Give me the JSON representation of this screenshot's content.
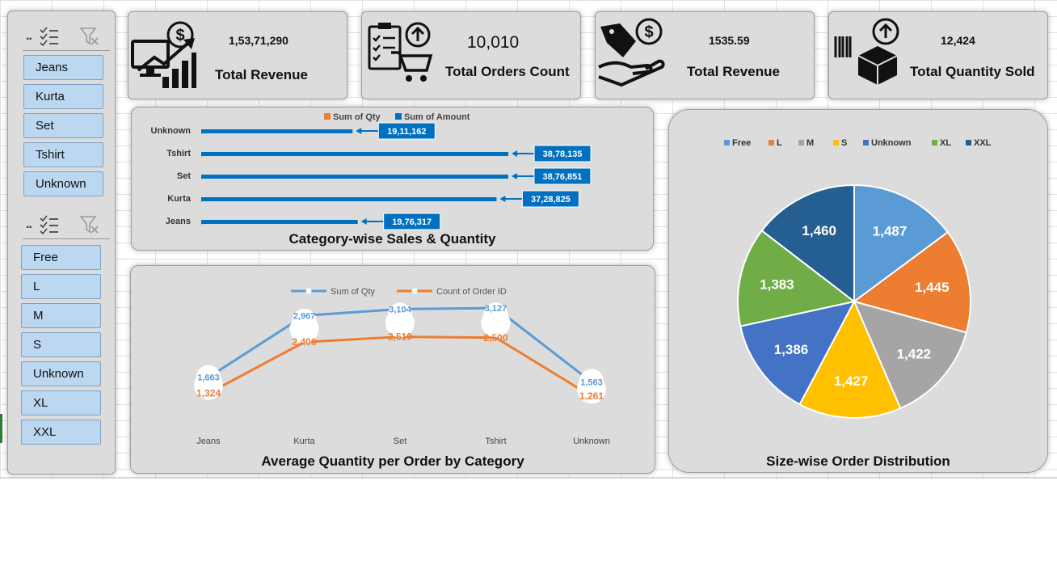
{
  "slicers": {
    "category": {
      "items": [
        "Jeans",
        "Kurta",
        "Set",
        "Tshirt",
        "Unknown"
      ]
    },
    "size": {
      "items": [
        "Free",
        "L",
        "M",
        "S",
        "Unknown",
        "XL",
        "XXL"
      ]
    }
  },
  "kpis": [
    {
      "value": "1,53,71,290",
      "label": "Total Revenue",
      "icon": "revenue-growth-icon"
    },
    {
      "value": "10,010",
      "label": "Total Orders Count",
      "icon": "order-checklist-cart-icon"
    },
    {
      "value": "1535.59",
      "label": "Total Revenue",
      "icon": "money-hand-icon"
    },
    {
      "value": "12,424",
      "label": "Total Quantity Sold",
      "icon": "box-upload-icon"
    }
  ],
  "chart_data": [
    {
      "type": "bar",
      "orientation": "horizontal",
      "title": "Category-wise Sales & Quantity",
      "categories": [
        "Unknown",
        "Tshirt",
        "Set",
        "Kurta",
        "Jeans"
      ],
      "series": [
        {
          "name": "Sum of Qty",
          "color": "#ed7d31",
          "values": [
            1563,
            3127,
            3104,
            2967,
            1663
          ]
        },
        {
          "name": "Sum of Amount",
          "color": "#0070c0",
          "values": [
            1911162,
            3878135,
            3876851,
            3728825,
            1976317
          ]
        }
      ],
      "data_labels": [
        "19,11,162",
        "38,78,135",
        "38,76,851",
        "37,28,825",
        "19,76,317"
      ],
      "legend": "top"
    },
    {
      "type": "line",
      "title": "Average Quantity per Order by Category",
      "categories": [
        "Jeans",
        "Kurta",
        "Set",
        "Tshirt",
        "Unknown"
      ],
      "series": [
        {
          "name": "Sum of Qty",
          "color": "#5b9bd5",
          "values": [
            1663,
            2967,
            3104,
            3127,
            1563
          ],
          "labels": [
            "1,663",
            "2,967",
            "3,104",
            "3,127",
            "1,563"
          ]
        },
        {
          "name": "Count of Order ID",
          "color": "#ed7d31",
          "values": [
            1324,
            2406,
            2519,
            2500,
            1261
          ],
          "labels": [
            "1,324",
            "2,406",
            "2,519",
            "2,500",
            "1,261"
          ]
        }
      ],
      "legend": "top"
    },
    {
      "type": "pie",
      "title": "Size-wise Order Distribution",
      "categories": [
        "Free",
        "L",
        "M",
        "S",
        "Unknown",
        "XL",
        "XXL"
      ],
      "values": [
        1487,
        1445,
        1422,
        1427,
        1386,
        1383,
        1460
      ],
      "labels": [
        "1,487",
        "1,445",
        "1,422",
        "1,427",
        "1,386",
        "1,383",
        "1,460"
      ],
      "colors": [
        "#5b9bd5",
        "#ed7d31",
        "#a5a5a5",
        "#ffc000",
        "#4472c4",
        "#70ad47",
        "#255e91"
      ],
      "legend": "top"
    }
  ]
}
